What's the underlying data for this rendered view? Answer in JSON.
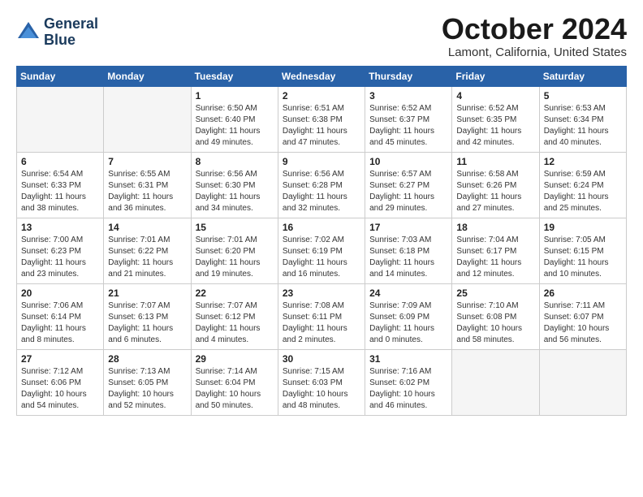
{
  "header": {
    "logo_line1": "General",
    "logo_line2": "Blue",
    "month": "October 2024",
    "location": "Lamont, California, United States"
  },
  "days_of_week": [
    "Sunday",
    "Monday",
    "Tuesday",
    "Wednesday",
    "Thursday",
    "Friday",
    "Saturday"
  ],
  "weeks": [
    [
      {
        "day": "",
        "info": ""
      },
      {
        "day": "",
        "info": ""
      },
      {
        "day": "1",
        "info": "Sunrise: 6:50 AM\nSunset: 6:40 PM\nDaylight: 11 hours\nand 49 minutes."
      },
      {
        "day": "2",
        "info": "Sunrise: 6:51 AM\nSunset: 6:38 PM\nDaylight: 11 hours\nand 47 minutes."
      },
      {
        "day": "3",
        "info": "Sunrise: 6:52 AM\nSunset: 6:37 PM\nDaylight: 11 hours\nand 45 minutes."
      },
      {
        "day": "4",
        "info": "Sunrise: 6:52 AM\nSunset: 6:35 PM\nDaylight: 11 hours\nand 42 minutes."
      },
      {
        "day": "5",
        "info": "Sunrise: 6:53 AM\nSunset: 6:34 PM\nDaylight: 11 hours\nand 40 minutes."
      }
    ],
    [
      {
        "day": "6",
        "info": "Sunrise: 6:54 AM\nSunset: 6:33 PM\nDaylight: 11 hours\nand 38 minutes."
      },
      {
        "day": "7",
        "info": "Sunrise: 6:55 AM\nSunset: 6:31 PM\nDaylight: 11 hours\nand 36 minutes."
      },
      {
        "day": "8",
        "info": "Sunrise: 6:56 AM\nSunset: 6:30 PM\nDaylight: 11 hours\nand 34 minutes."
      },
      {
        "day": "9",
        "info": "Sunrise: 6:56 AM\nSunset: 6:28 PM\nDaylight: 11 hours\nand 32 minutes."
      },
      {
        "day": "10",
        "info": "Sunrise: 6:57 AM\nSunset: 6:27 PM\nDaylight: 11 hours\nand 29 minutes."
      },
      {
        "day": "11",
        "info": "Sunrise: 6:58 AM\nSunset: 6:26 PM\nDaylight: 11 hours\nand 27 minutes."
      },
      {
        "day": "12",
        "info": "Sunrise: 6:59 AM\nSunset: 6:24 PM\nDaylight: 11 hours\nand 25 minutes."
      }
    ],
    [
      {
        "day": "13",
        "info": "Sunrise: 7:00 AM\nSunset: 6:23 PM\nDaylight: 11 hours\nand 23 minutes."
      },
      {
        "day": "14",
        "info": "Sunrise: 7:01 AM\nSunset: 6:22 PM\nDaylight: 11 hours\nand 21 minutes."
      },
      {
        "day": "15",
        "info": "Sunrise: 7:01 AM\nSunset: 6:20 PM\nDaylight: 11 hours\nand 19 minutes."
      },
      {
        "day": "16",
        "info": "Sunrise: 7:02 AM\nSunset: 6:19 PM\nDaylight: 11 hours\nand 16 minutes."
      },
      {
        "day": "17",
        "info": "Sunrise: 7:03 AM\nSunset: 6:18 PM\nDaylight: 11 hours\nand 14 minutes."
      },
      {
        "day": "18",
        "info": "Sunrise: 7:04 AM\nSunset: 6:17 PM\nDaylight: 11 hours\nand 12 minutes."
      },
      {
        "day": "19",
        "info": "Sunrise: 7:05 AM\nSunset: 6:15 PM\nDaylight: 11 hours\nand 10 minutes."
      }
    ],
    [
      {
        "day": "20",
        "info": "Sunrise: 7:06 AM\nSunset: 6:14 PM\nDaylight: 11 hours\nand 8 minutes."
      },
      {
        "day": "21",
        "info": "Sunrise: 7:07 AM\nSunset: 6:13 PM\nDaylight: 11 hours\nand 6 minutes."
      },
      {
        "day": "22",
        "info": "Sunrise: 7:07 AM\nSunset: 6:12 PM\nDaylight: 11 hours\nand 4 minutes."
      },
      {
        "day": "23",
        "info": "Sunrise: 7:08 AM\nSunset: 6:11 PM\nDaylight: 11 hours\nand 2 minutes."
      },
      {
        "day": "24",
        "info": "Sunrise: 7:09 AM\nSunset: 6:09 PM\nDaylight: 11 hours\nand 0 minutes."
      },
      {
        "day": "25",
        "info": "Sunrise: 7:10 AM\nSunset: 6:08 PM\nDaylight: 10 hours\nand 58 minutes."
      },
      {
        "day": "26",
        "info": "Sunrise: 7:11 AM\nSunset: 6:07 PM\nDaylight: 10 hours\nand 56 minutes."
      }
    ],
    [
      {
        "day": "27",
        "info": "Sunrise: 7:12 AM\nSunset: 6:06 PM\nDaylight: 10 hours\nand 54 minutes."
      },
      {
        "day": "28",
        "info": "Sunrise: 7:13 AM\nSunset: 6:05 PM\nDaylight: 10 hours\nand 52 minutes."
      },
      {
        "day": "29",
        "info": "Sunrise: 7:14 AM\nSunset: 6:04 PM\nDaylight: 10 hours\nand 50 minutes."
      },
      {
        "day": "30",
        "info": "Sunrise: 7:15 AM\nSunset: 6:03 PM\nDaylight: 10 hours\nand 48 minutes."
      },
      {
        "day": "31",
        "info": "Sunrise: 7:16 AM\nSunset: 6:02 PM\nDaylight: 10 hours\nand 46 minutes."
      },
      {
        "day": "",
        "info": ""
      },
      {
        "day": "",
        "info": ""
      }
    ]
  ]
}
